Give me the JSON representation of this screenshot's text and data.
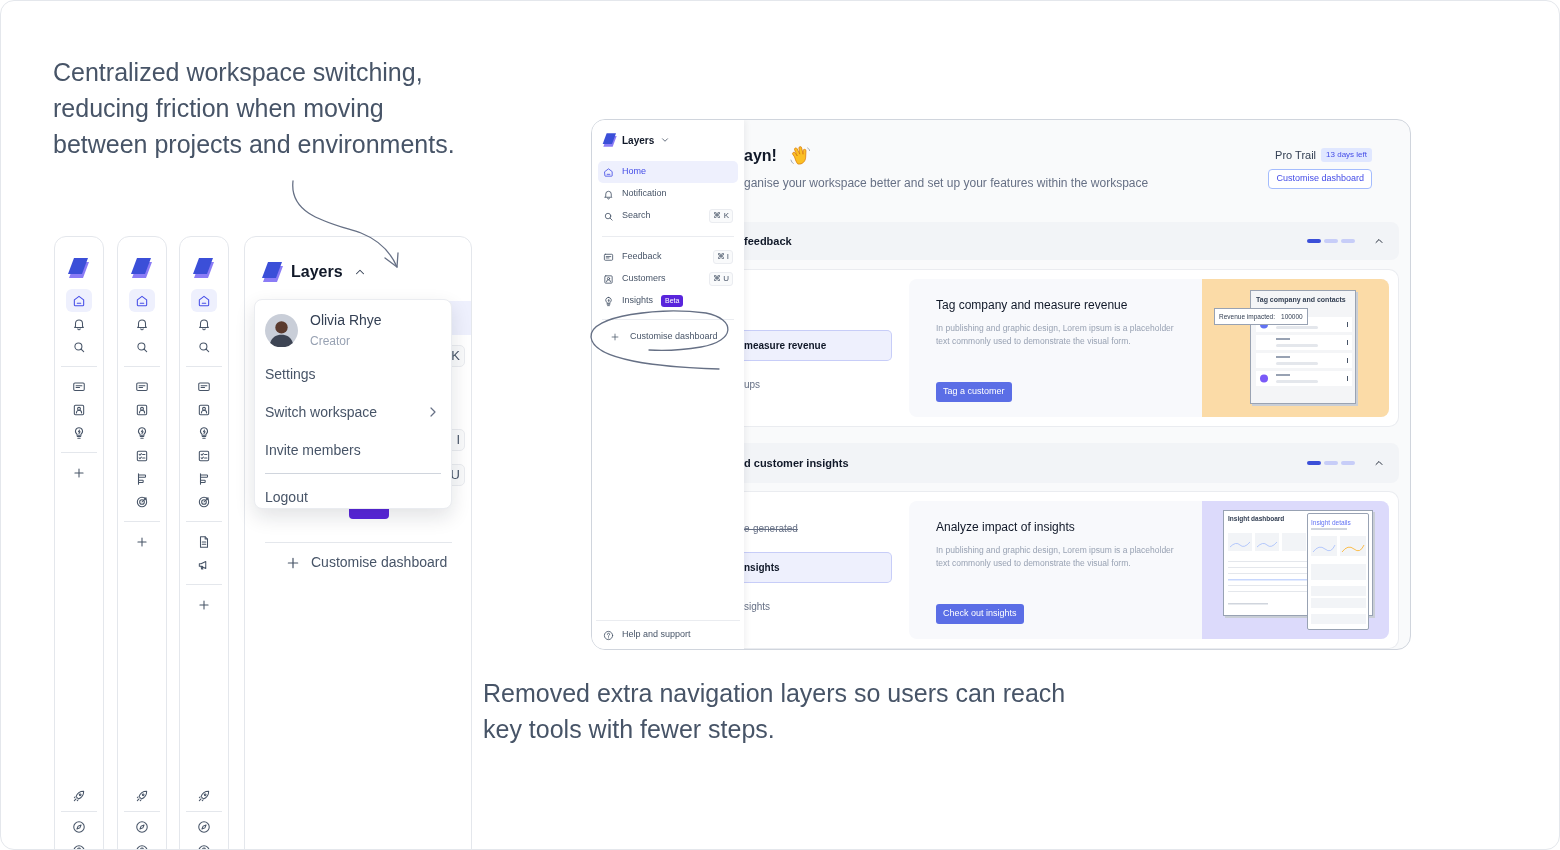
{
  "headline_lines": [
    "Centralized workspace switching,",
    "reducing friction when moving",
    "between projects and environments."
  ],
  "rails": [
    {
      "groups": [
        [
          {
            "kind": "home",
            "selected": true
          },
          {
            "kind": "bell",
            "selected": false
          },
          {
            "kind": "search",
            "selected": false
          }
        ],
        [
          {
            "kind": "message",
            "selected": false
          },
          {
            "kind": "contact",
            "selected": false
          },
          {
            "kind": "bulb",
            "selected": false
          }
        ],
        [
          {
            "kind": "plus",
            "selected": false
          }
        ]
      ],
      "footer": [
        {
          "kind": "rocket",
          "selected": false
        },
        {
          "kind": "compass",
          "selected": false
        },
        {
          "kind": "help",
          "selected": false
        }
      ]
    },
    {
      "groups": [
        [
          {
            "kind": "home",
            "selected": true
          },
          {
            "kind": "bell",
            "selected": false
          },
          {
            "kind": "search",
            "selected": false
          }
        ],
        [
          {
            "kind": "message",
            "selected": false
          },
          {
            "kind": "contact",
            "selected": false
          },
          {
            "kind": "bulb",
            "selected": false
          },
          {
            "kind": "checklist",
            "selected": false
          },
          {
            "kind": "bars",
            "selected": false
          },
          {
            "kind": "target",
            "selected": false
          }
        ],
        [
          {
            "kind": "plus",
            "selected": false
          }
        ]
      ],
      "footer": [
        {
          "kind": "rocket",
          "selected": false
        },
        {
          "kind": "compass",
          "selected": false
        },
        {
          "kind": "help",
          "selected": false
        }
      ]
    },
    {
      "groups": [
        [
          {
            "kind": "home",
            "selected": true
          },
          {
            "kind": "bell",
            "selected": false
          },
          {
            "kind": "search",
            "selected": false
          }
        ],
        [
          {
            "kind": "message",
            "selected": false
          },
          {
            "kind": "contact",
            "selected": false
          },
          {
            "kind": "bulb",
            "selected": false
          },
          {
            "kind": "checklist",
            "selected": false
          },
          {
            "kind": "bars",
            "selected": false
          },
          {
            "kind": "target",
            "selected": false
          }
        ],
        [
          {
            "kind": "file",
            "selected": false
          },
          {
            "kind": "megaphone",
            "selected": false
          }
        ],
        [
          {
            "kind": "plus",
            "selected": false
          }
        ]
      ],
      "footer": [
        {
          "kind": "rocket",
          "selected": false
        },
        {
          "kind": "compass",
          "selected": false
        },
        {
          "kind": "help",
          "selected": false
        }
      ]
    }
  ],
  "workspace_panel": {
    "title": "Layers",
    "expanded": true,
    "shortcuts": [
      "K",
      "I",
      "U"
    ],
    "action": "Customise dashboard"
  },
  "account_menu": {
    "name": "Olivia Rhye",
    "role": "Creator",
    "items": [
      {
        "label": "Settings",
        "submenu": false
      },
      {
        "label": "Switch workspace",
        "submenu": true
      },
      {
        "label": "Invite members",
        "submenu": false
      }
    ],
    "footer_items": [
      {
        "label": "Logout"
      }
    ]
  },
  "app": {
    "sidebar": {
      "title": "Layers",
      "expanded": false,
      "groups": [
        [
          {
            "label": "Home",
            "kind": "home",
            "selected": true
          },
          {
            "label": "Notification",
            "kind": "bell",
            "selected": false
          },
          {
            "label": "Search",
            "kind": "search",
            "shortcut": "⌘ K",
            "selected": false
          }
        ],
        [
          {
            "label": "Feedback",
            "kind": "message",
            "shortcut": "⌘ I",
            "selected": false
          },
          {
            "label": "Customers",
            "kind": "contact",
            "shortcut": "⌘ U",
            "selected": false
          },
          {
            "label": "Insights",
            "kind": "bulb",
            "badge": "Beta",
            "selected": false
          }
        ]
      ],
      "action": "Customise dashboard",
      "footer": "Help and support"
    },
    "greeting": "ayn!",
    "subtitle": "ganise your workspace better and set up your features within the workspace",
    "plan": "Pro Trail",
    "plan_badge": "13 days left",
    "customise_button": "Customise dashboard",
    "sections": [
      {
        "title": "feedback",
        "expanded": true,
        "progress": [
          {
            "done": true
          },
          {
            "done": false
          },
          {
            "done": false
          }
        ],
        "steps": [
          {
            "label": "measure revenue",
            "selected": true,
            "done": false
          },
          {
            "label": "ups",
            "selected": false,
            "done": false
          }
        ],
        "card": {
          "title": "Tag company and measure revenue",
          "description": "In publishing and graphic design, Lorem ipsum is a placeholder text commonly used to demonstrate the visual form.",
          "button": "Tag a customer",
          "illustration": {
            "kind": "contacts",
            "color": "#fbdba7",
            "title": "Tag company and contacts",
            "metric_label": "Revenue impacted:",
            "metric_value": "100000"
          }
        }
      },
      {
        "title": "d customer insights",
        "expanded": true,
        "progress": [
          {
            "done": true
          },
          {
            "done": false
          },
          {
            "done": false
          }
        ],
        "steps": [
          {
            "label": "e-generated",
            "selected": false,
            "done": true
          },
          {
            "label": "nsights",
            "selected": true,
            "done": false
          },
          {
            "label": "sights",
            "selected": false,
            "done": false
          }
        ],
        "card": {
          "title": "Analyze impact of insights",
          "description": "In publishing and graphic design, Lorem ipsum is a placeholder text commonly used to demonstrate the visual form.",
          "button": "Check out insights",
          "illustration": {
            "kind": "dashboard",
            "color": "#dcdafb",
            "title": "Insight dashboard",
            "side_title": "Insight details"
          }
        }
      }
    ]
  },
  "caption_lines": [
    "Removed extra navigation layers so users can reach",
    "key tools with fewer steps."
  ]
}
